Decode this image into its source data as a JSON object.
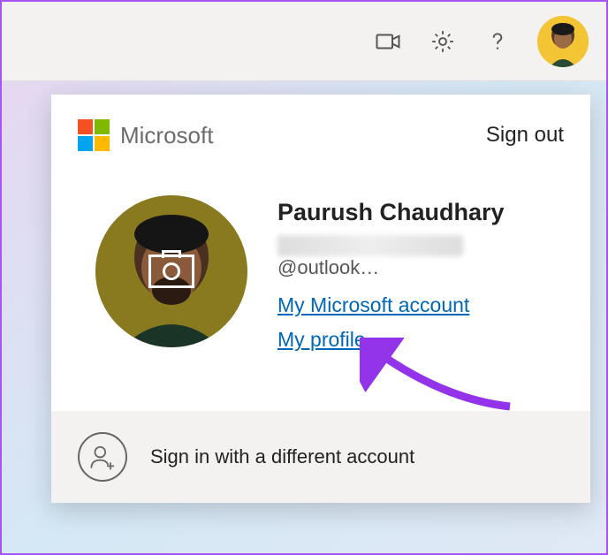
{
  "brand": {
    "name": "Microsoft"
  },
  "topbar": {
    "signout_label": "Sign out"
  },
  "account": {
    "display_name": "Paurush Chaudhary",
    "email_visible_suffix": "@outlook…",
    "links": {
      "ms_account": "My Microsoft account",
      "my_profile": "My profile"
    }
  },
  "footer": {
    "add_account_label": "Sign in with a different account"
  },
  "colors": {
    "link": "#0067b8",
    "arrow": "#9333ea"
  }
}
